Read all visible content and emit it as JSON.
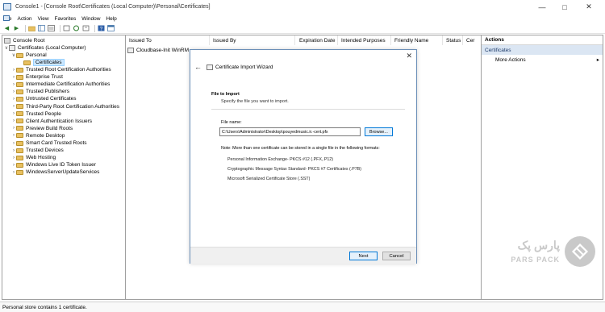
{
  "window": {
    "title": "Console1 - [Console Root\\Certificates (Local Computer)\\Personal\\Certificates]",
    "minimize_icon": "minimize-icon",
    "maximize_icon": "maximize-icon",
    "close_icon": "close-icon"
  },
  "menu": [
    "File",
    "Action",
    "View",
    "Favorites",
    "Window",
    "Help"
  ],
  "tree": {
    "root": "Console Root",
    "computer": "Certificates (Local Computer)",
    "personal": "Personal",
    "certificates": "Certificates",
    "stores": [
      "Trusted Root Certification Authorities",
      "Enterprise Trust",
      "Intermediate Certification Authorities",
      "Trusted Publishers",
      "Untrusted Certificates",
      "Third-Party Root Certification Authorities",
      "Trusted People",
      "Client Authentication Issuers",
      "Preview Build Roots",
      "Remote Desktop",
      "Smart Card Trusted Roots",
      "Trusted Devices",
      "Web Hosting",
      "Windows Live ID Token Issuer",
      "WindowsServerUpdateServices"
    ]
  },
  "list": {
    "columns": [
      "Issued To",
      "Issued By",
      "Expiration Date",
      "Intended Purposes",
      "Friendly Name",
      "Status",
      "Cer"
    ],
    "rows": [
      {
        "issued_to": "Cloudbase-Init WinRM"
      }
    ]
  },
  "actions": {
    "header": "Actions",
    "section": "Certificates",
    "items": [
      "More Actions"
    ]
  },
  "status_bar": "Personal store contains 1 certificate.",
  "dialog": {
    "title": "Certificate Import Wizard",
    "heading": "File to Import",
    "subheading": "Specify the file you want to import.",
    "file_label": "File name:",
    "file_value": "C:\\Users\\Administrator\\Desktop\\pouyedmusic.ir.-cert.pfx",
    "browse_label": "Browse...",
    "note": "Note:  More than one certificate can be stored in a single file in the following formats:",
    "formats": [
      "Personal Information Exchange- PKCS #12 (.PFX,.P12)",
      "Cryptographic Message Syntax Standard- PKCS #7 Certificates (.P7B)",
      "Microsoft Serialized Certificate Store (.SST)"
    ],
    "next_label": "Next",
    "cancel_label": "Cancel"
  },
  "watermark": {
    "text_fa": "پارس پک",
    "text_en": "PARS PACK"
  }
}
